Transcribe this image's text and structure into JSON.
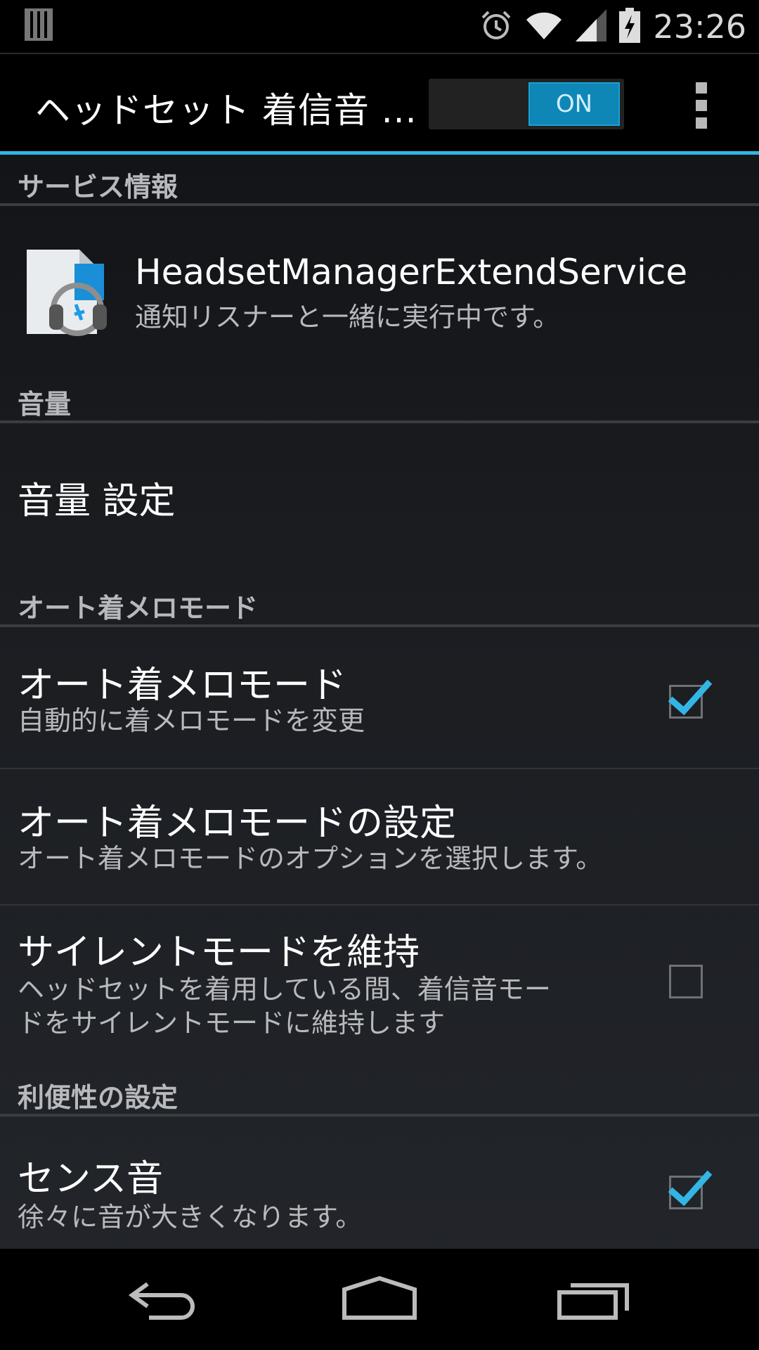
{
  "status_bar": {
    "time": "23:26",
    "icons": [
      "notification-bars-icon",
      "alarm-icon",
      "wifi-icon",
      "cell-signal-icon",
      "battery-charging-icon"
    ]
  },
  "action_bar": {
    "title": "ヘッドセット 着信音 ...",
    "toggle_label": "ON",
    "toggle_state": "on"
  },
  "sections": {
    "service_info": {
      "header": "サービス情報",
      "service_name": "HeadsetManagerExtendService",
      "service_status": "通知リスナーと一緒に実行中です。"
    },
    "volume": {
      "header": "音量",
      "item_title": "音量 設定"
    },
    "auto_ring_mode": {
      "header": "オート着メロモード",
      "items": [
        {
          "title": "オート着メロモード",
          "summary": "自動的に着メロモードを変更",
          "checked": true
        },
        {
          "title": "オート着メロモードの設定",
          "summary": "オート着メロモードのオプションを選択します。"
        },
        {
          "title": "サイレントモードを維持",
          "summary_line1": "ヘッドセットを着用している間、着信音モー",
          "summary_line2": "ドをサイレントモードに維持します",
          "checked": false
        }
      ]
    },
    "convenience": {
      "header": "利便性の設定",
      "items": [
        {
          "title": "センス音",
          "summary": "徐々に音が大きくなります。",
          "checked": true
        }
      ]
    }
  },
  "colors": {
    "accent": "#33b5e5",
    "toggle_on": "#0e86b6"
  }
}
